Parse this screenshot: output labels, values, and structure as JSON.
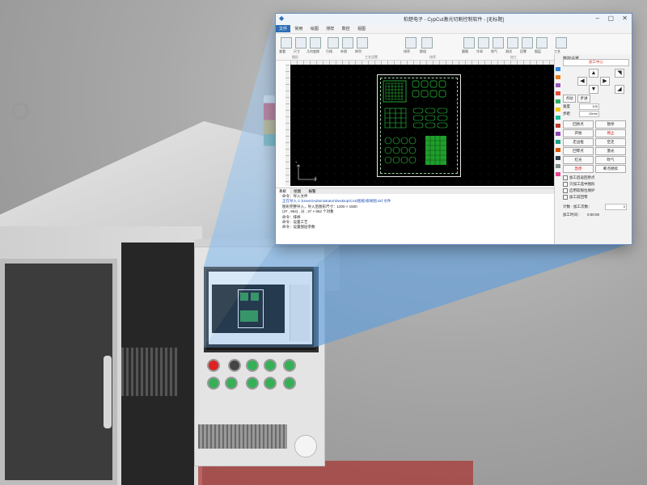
{
  "window": {
    "title": "柏楚电子 - CypCut激光切割控制软件 - [无标题]",
    "controls": {
      "minimize": "–",
      "maximize": "▢",
      "close": "✕"
    }
  },
  "menu": [
    "文件",
    "常用",
    "绘图",
    "排样",
    "数控",
    "视图"
  ],
  "ribbon": {
    "left_buttons": [
      "查看",
      "尺寸",
      "几何变换",
      "引线",
      "补偿",
      "阵列",
      "排序",
      "群组"
    ],
    "right_buttons": [
      "跟随",
      "冷却",
      "吹气",
      "测试",
      "回零",
      "图层",
      "工艺"
    ],
    "groups": [
      "图形",
      "工艺设置",
      "排序",
      "加工"
    ]
  },
  "canvas": {
    "origin_label": "X",
    "origin_label_y": "Y"
  },
  "layers": [
    "#2e86de",
    "#e67e22",
    "#9b59b6",
    "#e74c3c",
    "#27ae60",
    "#f1c40f",
    "#1abc9c",
    "#c0392b",
    "#8e44ad",
    "#16a085",
    "#d35400",
    "#2c3e50",
    "#7f8c8d",
    "#e84393"
  ],
  "side": {
    "title": "数控设置",
    "machine_dropdown": "加工中心",
    "jog_arrows": {
      "up": "▲",
      "down": "▼",
      "left": "◀",
      "right": "▶",
      "up_left": "◤",
      "up_right": "◥",
      "down_left": "◣",
      "down_right": "◢"
    },
    "jog_buttons": [
      "点动",
      "步进"
    ],
    "speed_label": "速度",
    "speed_value": "100",
    "step_label": "步距",
    "step_value": "10mm",
    "buttons": [
      "回原点",
      "暂停",
      "开始",
      "停止",
      "走边框",
      "空走",
      "回零点",
      "激光",
      "红光",
      "吹气",
      "急停",
      "断点继续"
    ],
    "checkboxes": [
      "加工后返回原点",
      "只加工选中图形",
      "启用软限位保护",
      "加工前回零"
    ],
    "count_label": "计数 - 加工次数：",
    "count_value": "0",
    "time_label": "加工时间：",
    "time_value": "0:00:00"
  },
  "bottom_tabs": [
    "系统",
    "绘图",
    "报警"
  ],
  "log": [
    {
      "text": "命令：导入文件",
      "style": ""
    },
    {
      "text": "正在导入 C:\\Users\\Administrator\\Desktop\\CAD图纸\\排样图.dxf 文件",
      "style": "blue"
    },
    {
      "text": "图形完整导入，导入后图形尺寸：1200 × 1500",
      "style": ""
    },
    {
      "text": "(37 , 964) , 分 , 37 × 962 个对象",
      "style": ""
    },
    {
      "text": "命令：排样",
      "style": ""
    },
    {
      "text": "命令：设置工艺",
      "style": ""
    },
    {
      "text": "命令：设置图层参数",
      "style": ""
    }
  ]
}
